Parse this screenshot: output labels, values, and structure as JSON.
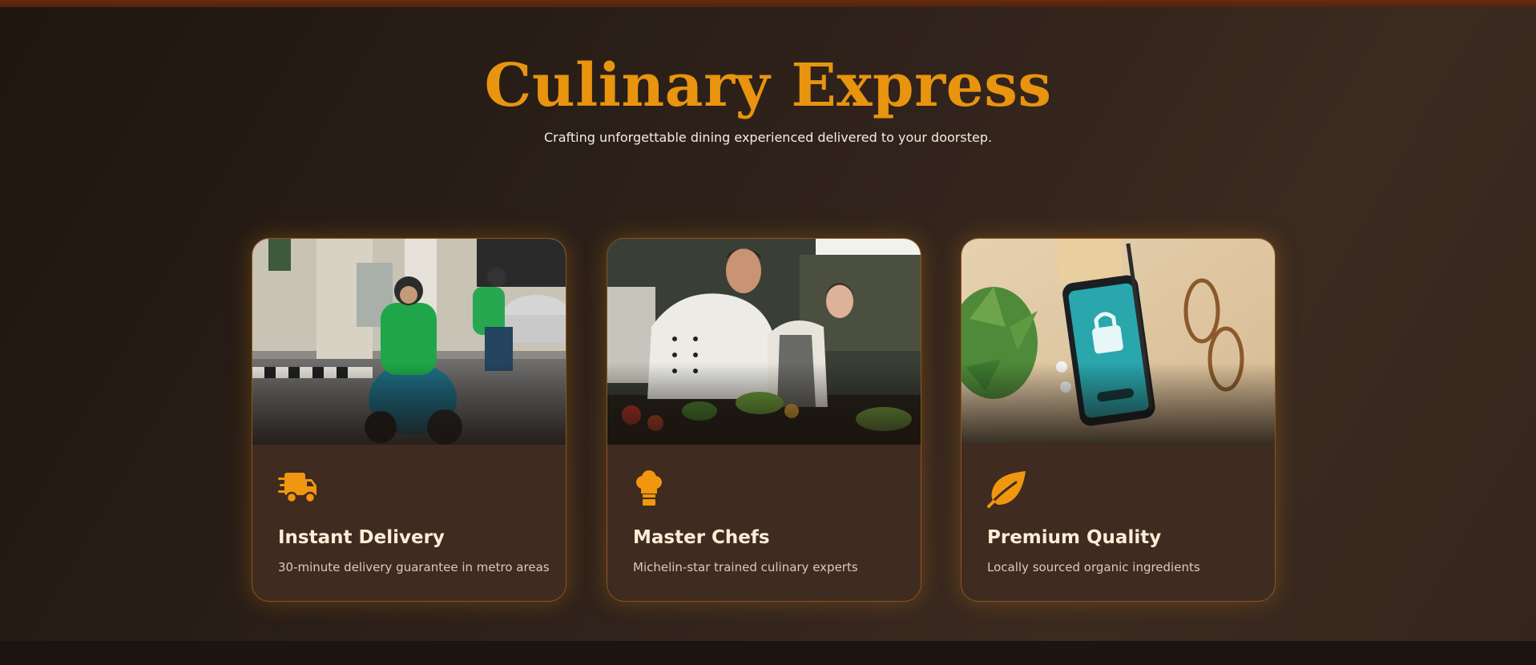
{
  "hero": {
    "title": "Culinary Express",
    "subtitle": "Crafting unforgettable dining experienced delivered to your doorstep."
  },
  "features": [
    {
      "icon": "delivery-truck-icon",
      "image": "delivery-riders-photo",
      "title": "Instant Delivery",
      "description": "30-minute delivery guarantee in metro areas"
    },
    {
      "icon": "chef-hat-icon",
      "image": "chefs-cooking-photo",
      "title": "Master Chefs",
      "description": "Michelin-star trained culinary experts"
    },
    {
      "icon": "leaf-icon",
      "image": "phone-on-desk-photo",
      "title": "Premium Quality",
      "description": "Locally sourced organic ingredients"
    }
  ],
  "colors": {
    "accent": "#e8940f",
    "background": "#2c2019",
    "card": "#3f2b20",
    "card_border": "#8a5420",
    "heading_text": "#fbeed6",
    "body_text": "#d9cbbd"
  }
}
